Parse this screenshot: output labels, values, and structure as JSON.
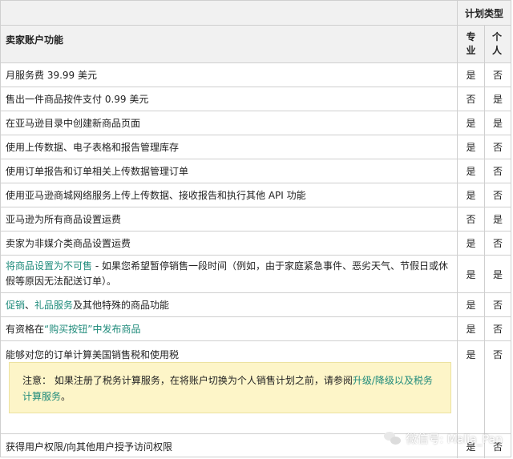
{
  "header": {
    "plan_type": "计划类型",
    "feature_col": "卖家账户功能",
    "pro_col": "专业",
    "ind_col": "个人"
  },
  "rows": [
    {
      "feature": "月服务费 39.99 美元",
      "pro": "是",
      "ind": "否"
    },
    {
      "feature": "售出一件商品按件支付 0.99 美元",
      "pro": "否",
      "ind": "是"
    },
    {
      "feature": "在亚马逊目录中创建新商品页面",
      "pro": "是",
      "ind": "是"
    },
    {
      "feature": "使用上传数据、电子表格和报告管理库存",
      "pro": "是",
      "ind": "否"
    },
    {
      "feature": "使用订单报告和订单相关上传数据管理订单",
      "pro": "是",
      "ind": "否"
    },
    {
      "feature": "使用亚马逊商城网络服务上传上传数据、接收报告和执行其他 API 功能",
      "pro": "是",
      "ind": "否"
    },
    {
      "feature": "亚马逊为所有商品设置运费",
      "pro": "否",
      "ind": "是"
    },
    {
      "feature": "卖家为非媒介类商品设置运费",
      "pro": "是",
      "ind": "否"
    }
  ],
  "unavailable_row": {
    "link": "将商品设置为不可售",
    "text": " - 如果您希望暂停销售一段时间（例如，由于家庭紧急事件、恶劣天气、节假日或休假等原因无法配送订单）。",
    "pro": "是",
    "ind": "是"
  },
  "promo_row": {
    "link1": "促销",
    "sep": "、",
    "link2": "礼品服务",
    "text": "及其他特殊的商品功能",
    "pro": "是",
    "ind": "否"
  },
  "buybox_row": {
    "text": "有资格在",
    "link": "“购买按钮”中发布商品",
    "pro": "是",
    "ind": "否"
  },
  "tax_row": {
    "text": "能够对您的订单计算美国销售税和使用税",
    "pro": "是",
    "ind": "否",
    "note_prefix": "注意： 如果注册了税务计算服务，在将账户切换为个人销售计划之前，请参阅",
    "note_link": "升级/降级以及税务计算服务",
    "note_suffix": "。"
  },
  "access_row": {
    "feature": "获得用户权限/向其他用户授予访问权限",
    "pro": "是",
    "ind": "否"
  },
  "watermark": "微信号: Malia_Pan"
}
